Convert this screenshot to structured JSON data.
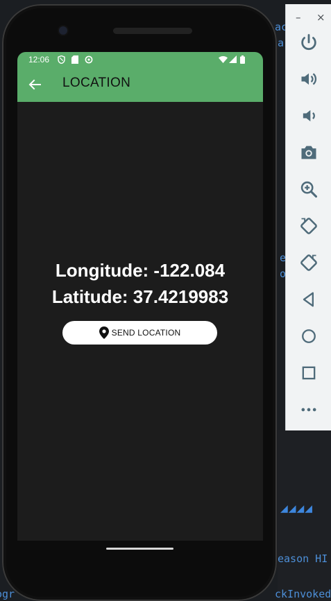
{
  "background": {
    "code_fragments": [
      "ac",
      "ar",
      "e",
      "o",
      "eason HI",
      "ckInvokedC",
      "ogr"
    ]
  },
  "emulator": {
    "window_controls": [
      "–",
      "×"
    ],
    "buttons": [
      {
        "name": "power",
        "icon": "power-icon"
      },
      {
        "name": "volume-up",
        "icon": "volume-up-icon"
      },
      {
        "name": "volume-down",
        "icon": "volume-down-icon"
      },
      {
        "name": "screenshot",
        "icon": "camera-icon"
      },
      {
        "name": "zoom",
        "icon": "zoom-in-icon"
      },
      {
        "name": "rotate-left",
        "icon": "rotate-left-icon"
      },
      {
        "name": "rotate-right",
        "icon": "rotate-right-icon"
      },
      {
        "name": "back",
        "icon": "back-triangle-icon"
      },
      {
        "name": "home",
        "icon": "home-circle-icon"
      },
      {
        "name": "overview",
        "icon": "overview-square-icon"
      },
      {
        "name": "more",
        "icon": "more-icon"
      }
    ]
  },
  "status_bar": {
    "time": "12:06"
  },
  "app_bar": {
    "title": "LOCATION",
    "color": "#5aad6a"
  },
  "location": {
    "longitude_text": "Longitude: -122.084",
    "latitude_text": "Latitude: 37.4219983"
  },
  "send_button": {
    "label": "SEND LOCATION"
  }
}
